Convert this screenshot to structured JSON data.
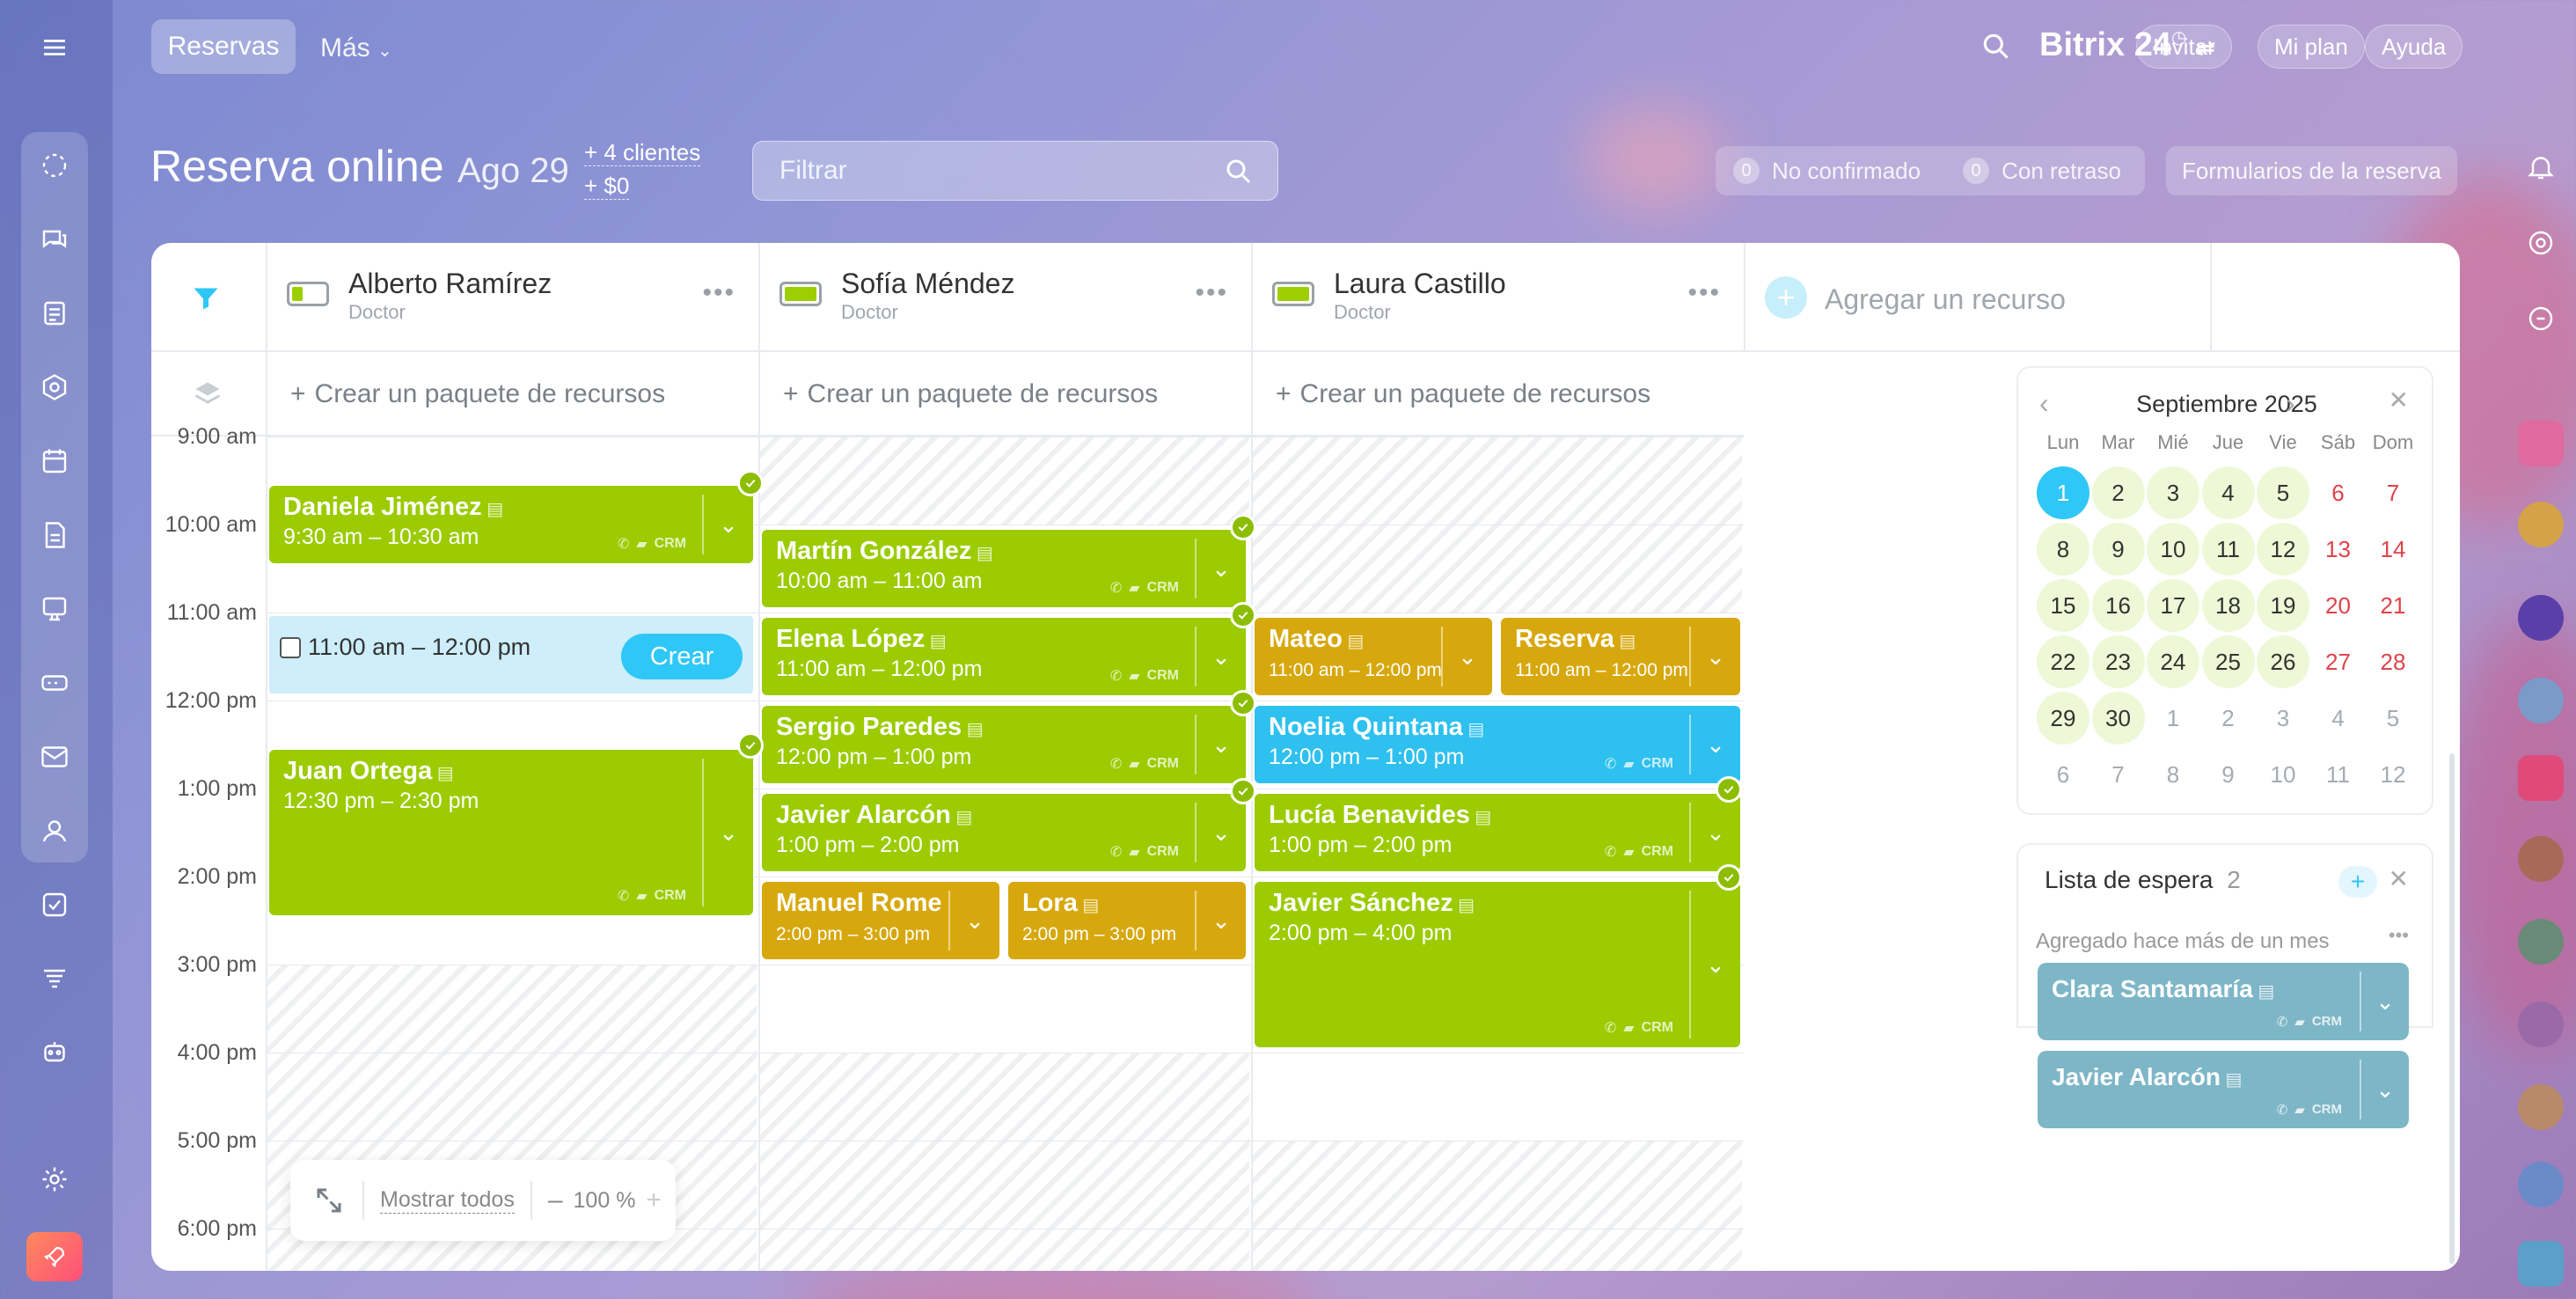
{
  "topbar": {
    "tab_active": "Reservas",
    "tab_more": "Más",
    "brand": "Bitrix 24",
    "invite": "Invitar",
    "plan": "Mi plan",
    "help": "Ayuda"
  },
  "header": {
    "title": "Reserva online",
    "date": "Ago 29",
    "clients": "+ 4 clientes",
    "revenue": "+ $0",
    "filter_placeholder": "Filtrar",
    "unconfirmed_count": "0",
    "unconfirmed_label": "No confirmado",
    "delayed_count": "0",
    "delayed_label": "Con retraso",
    "forms_button": "Formularios de la reserva"
  },
  "resources": [
    {
      "name": "Alberto Ramírez",
      "role": "Doctor",
      "package": "Crear un paquete de recursos"
    },
    {
      "name": "Sofía Méndez",
      "role": "Doctor",
      "package": "Crear un paquete de recursos"
    },
    {
      "name": "Laura Castillo",
      "role": "Doctor",
      "package": "Crear un paquete de recursos"
    }
  ],
  "add_resource": "Agregar un recurso",
  "times": [
    "9:00 am",
    "10:00 am",
    "11:00 am",
    "12:00 pm",
    "1:00 pm",
    "2:00 pm",
    "3:00 pm",
    "4:00 pm",
    "5:00 pm",
    "6:00 pm"
  ],
  "events": [
    {
      "name": "Daniela Jiménez",
      "time": "9:30 am – 10:30 am",
      "color": "green"
    },
    {
      "name": "Juan Ortega",
      "time": "12:30 pm – 2:30 pm",
      "color": "green"
    },
    {
      "name": "Martín González",
      "time": "10:00 am – 11:00 am",
      "color": "green"
    },
    {
      "name": "Elena López",
      "time": "11:00 am – 12:00 pm",
      "color": "green"
    },
    {
      "name": "Sergio Paredes",
      "time": "12:00 pm – 1:00 pm",
      "color": "green"
    },
    {
      "name": "Javier Alarcón",
      "time": "1:00 pm – 2:00 pm",
      "color": "green"
    },
    {
      "name": "Manuel Romero",
      "time": "2:00 pm – 3:00 pm",
      "color": "yellow"
    },
    {
      "name": "Lora",
      "time": "2:00 pm – 3:00 pm",
      "color": "yellow"
    },
    {
      "name": "Mateo",
      "time": "11:00 am – 12:00 pm",
      "color": "yellow"
    },
    {
      "name": "Reserva",
      "time": "11:00 am – 12:00 pm",
      "color": "yellow"
    },
    {
      "name": "Noelia Quintana",
      "time": "12:00 pm – 1:00 pm",
      "color": "blue"
    },
    {
      "name": "Lucía Benavides",
      "time": "1:00 pm – 2:00 pm",
      "color": "green"
    },
    {
      "name": "Javier Sánchez",
      "time": "2:00 pm – 4:00 pm",
      "color": "green"
    }
  ],
  "new_slot": {
    "time": "11:00 am – 12:00 pm",
    "button": "Crear"
  },
  "crm_label": "CRM",
  "zoom": {
    "show_all": "Mostrar todos",
    "level": "100 %"
  },
  "calendar": {
    "month": "Septiembre 2025",
    "weekdays": [
      "Lun",
      "Mar",
      "Mié",
      "Jue",
      "Vie",
      "Sáb",
      "Dom"
    ],
    "weeks": [
      [
        "1",
        "2",
        "3",
        "4",
        "5",
        "6",
        "7"
      ],
      [
        "8",
        "9",
        "10",
        "11",
        "12",
        "13",
        "14"
      ],
      [
        "15",
        "16",
        "17",
        "18",
        "19",
        "20",
        "21"
      ],
      [
        "22",
        "23",
        "24",
        "25",
        "26",
        "27",
        "28"
      ],
      [
        "29",
        "30",
        "1",
        "2",
        "3",
        "4",
        "5"
      ],
      [
        "6",
        "7",
        "8",
        "9",
        "10",
        "11",
        "12"
      ]
    ],
    "selected": "1"
  },
  "waitlist": {
    "title": "Lista de espera",
    "count": "2",
    "group": "Agregado hace más de un mes",
    "items": [
      "Clara Santamaría",
      "Javier Alarcón"
    ]
  }
}
